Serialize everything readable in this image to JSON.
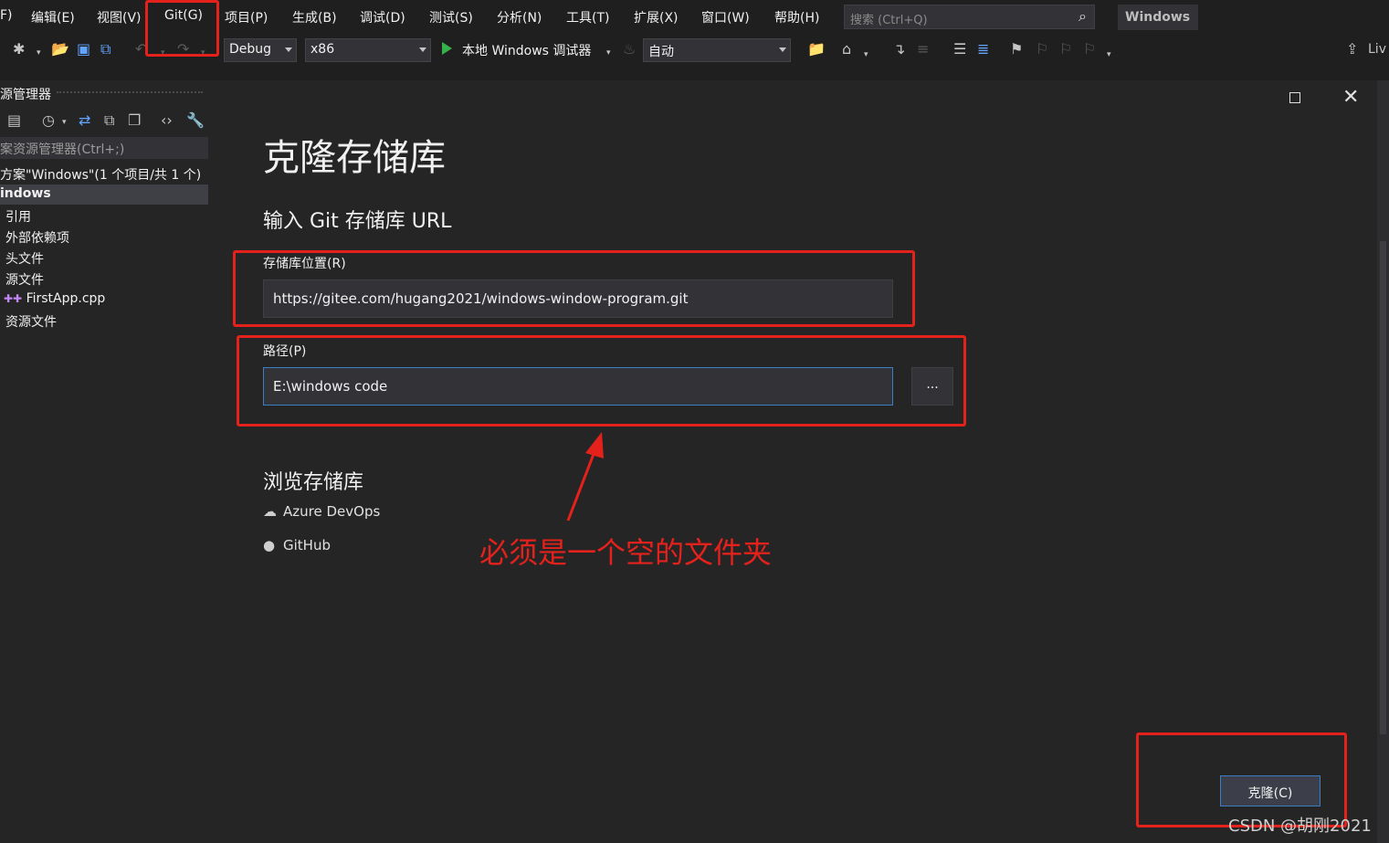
{
  "menu": {
    "items": [
      "F)",
      "编辑(E)",
      "视图(V)",
      "Git(G)",
      "项目(P)",
      "生成(B)",
      "调试(D)",
      "测试(S)",
      "分析(N)",
      "工具(T)",
      "扩展(X)",
      "窗口(W)",
      "帮助(H)"
    ],
    "search_placeholder": "搜索 (Ctrl+Q)",
    "window_title": "Windows"
  },
  "toolbar": {
    "config": "Debug",
    "platform": "x86",
    "run_label": "本地 Windows 调试器",
    "run_mode": "自动",
    "live_share": "Liv"
  },
  "solution_explorer": {
    "title": "源管理器",
    "search_placeholder": "案资源管理器(Ctrl+;)",
    "solution_label": "方案\"Windows\"(1 个项目/共 1 个)",
    "project": "indows",
    "items": [
      "引用",
      "外部依赖项",
      "头文件",
      "源文件",
      "FirstApp.cpp",
      "资源文件"
    ]
  },
  "dialog": {
    "title": "克隆存储库",
    "subtitle": "输入 Git 存储库 URL",
    "repo_label": "存储库位置(R)",
    "repo_value": "https://gitee.com/hugang2021/windows-window-program.git",
    "path_label": "路径(P)",
    "path_value": "E:\\windows code",
    "browse_label": "...",
    "browse_heading": "浏览存储库",
    "providers": [
      "Azure DevOps",
      "GitHub"
    ],
    "clone_label": "克隆(C)"
  },
  "annotation": {
    "text": "必须是一个空的文件夹",
    "color": "#e5211c"
  },
  "watermark": "CSDN @胡刚2021",
  "colors": {
    "background": "#1f1f1f",
    "panel": "#252526",
    "accent": "#3a7ec3"
  }
}
